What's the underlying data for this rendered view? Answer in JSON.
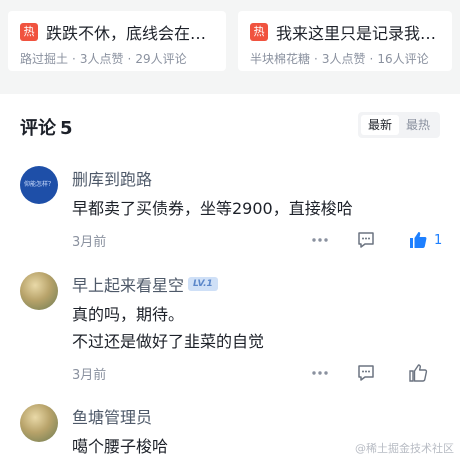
{
  "related": [
    {
      "hot": "热",
      "title": "跌跌不休，底线会在…",
      "author": "路过掘土",
      "likes": "3人点赞",
      "comments": "29人评论"
    },
    {
      "hot": "热",
      "title": "我来这里只是记录我…",
      "author": "半块棉花糖",
      "likes": "3人点赞",
      "comments": "16人评论"
    }
  ],
  "comment_section": {
    "title": "评论",
    "count": "5",
    "sort_newest": "最新",
    "sort_hottest": "最热"
  },
  "comments": [
    {
      "user": "删库到跑路",
      "avatar_text": "仰能怎样？",
      "lines": [
        "早都卖了买债券，坐等2900，直接梭哈"
      ],
      "time": "3月前",
      "like_count": "1",
      "liked": true
    },
    {
      "user": "早上起来看星空",
      "level": "LV.1",
      "lines": [
        "真的吗，期待。",
        "不过还是做好了韭菜的自觉"
      ],
      "time": "3月前",
      "liked": false
    },
    {
      "user": "鱼塘管理员",
      "lines": [
        "噶个腰子梭哈"
      ]
    }
  ],
  "watermark": "@稀土掘金技术社区",
  "colors": {
    "hot_badge": "#f0533f",
    "accent": "#1e80ff",
    "muted": "#8a919f"
  }
}
